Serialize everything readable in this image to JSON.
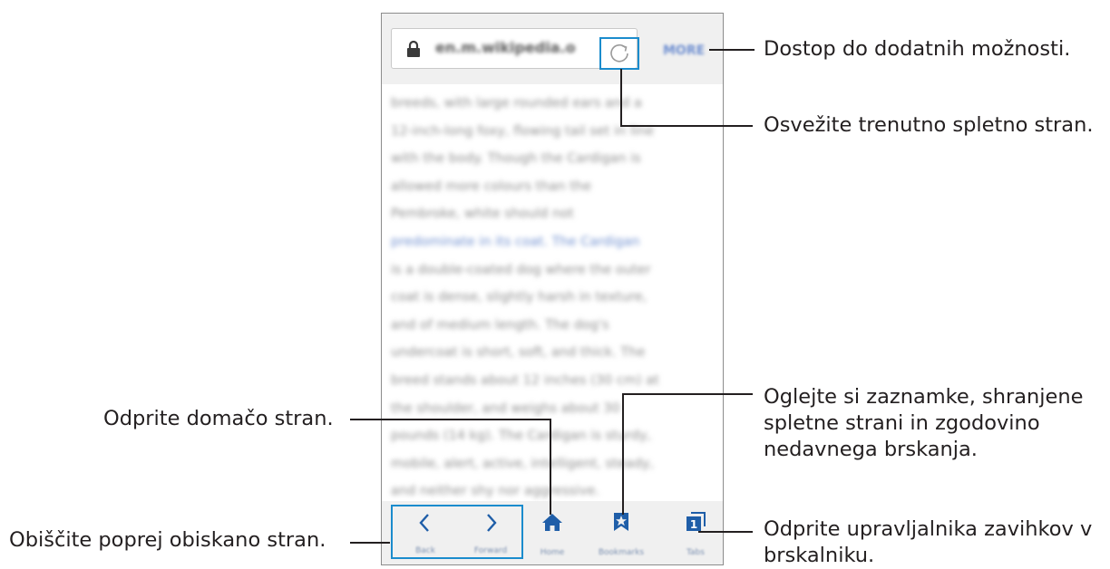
{
  "browser": {
    "url": "en.m.wikipedia.o",
    "more_label": "MORE",
    "article_lines": [
      "breeds, with large rounded ears and a",
      "12-inch-long foxy, flowing tail set in line",
      "with the body. Though the Cardigan is",
      "allowed more colours than the",
      "Pembroke, white should not",
      "predominate in its coat. The Cardigan",
      "is a double-coated dog where the outer",
      "coat is dense, slightly harsh in texture,",
      "and of medium length. The dog's",
      "undercoat is short, soft, and thick. The",
      "breed stands about 12 inches (30 cm) at",
      "the shoulder, and weighs about 30",
      "pounds (14 kg). The Cardigan is sturdy,",
      "mobile, alert, active, intelligent, steady,",
      "and neither shy nor aggressive."
    ],
    "bottom_bar": {
      "back": "Back",
      "forward": "Forward",
      "home": "Home",
      "bookmarks": "Bookmarks",
      "tabs": "Tabs",
      "tabs_count": "1"
    }
  },
  "callouts": {
    "more": "Dostop do dodatnih možnosti.",
    "reload": "Osvežite trenutno spletno stran.",
    "bookmarks": [
      "Oglejte si zaznamke, shranjene",
      "spletne strani in zgodovino",
      "nedavnega brskanja."
    ],
    "home": "Odprite domačo stran.",
    "back": "Obiščite poprej obiskano stran.",
    "tabs": [
      "Odprite upravljalnika zavihkov v",
      "brskalniku."
    ]
  },
  "colors": {
    "highlight": "#1b8ccd",
    "icon": "#1f5ea8",
    "link": "#6f8fd0",
    "bar": "#f0f0f0"
  }
}
